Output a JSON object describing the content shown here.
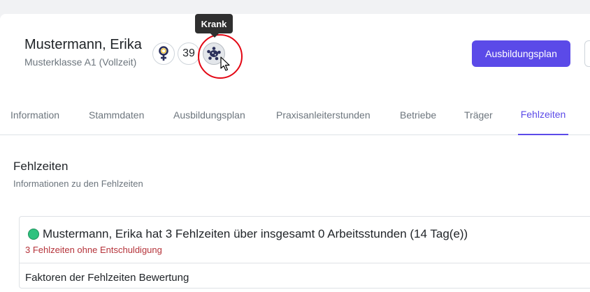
{
  "student": {
    "name": "Mustermann, Erika",
    "class": "Musterklasse A1 (Vollzeit)",
    "age": "39"
  },
  "icons": {
    "gender": "female-icon",
    "sick": "virus-icon",
    "cursor": "pointer-cursor-icon"
  },
  "tooltip": {
    "text": "Krank"
  },
  "header": {
    "primary_button": "Ausbildungsplan"
  },
  "tabs": [
    {
      "label": "Information"
    },
    {
      "label": "Stammdaten"
    },
    {
      "label": "Ausbildungsplan"
    },
    {
      "label": "Praxisanleiterstunden"
    },
    {
      "label": "Betriebe"
    },
    {
      "label": "Träger"
    },
    {
      "label": "Fehlzeiten",
      "active": true
    }
  ],
  "section": {
    "title": "Fehlzeiten",
    "subtitle": "Informationen zu den Fehlzeiten"
  },
  "absence": {
    "summary": "Mustermann, Erika hat 3 Fehlzeiten über insgesamt 0 Arbeitsstunden (14 Tag(e))",
    "warning": "3 Fehlzeiten ohne Entschuldigung",
    "factors_label": "Faktoren der Fehlzeiten Bewertung"
  },
  "colors": {
    "primary": "#5b4ae8",
    "status_ok": "#2ec27e",
    "warning": "#b5333a",
    "highlight": "#e30613"
  }
}
